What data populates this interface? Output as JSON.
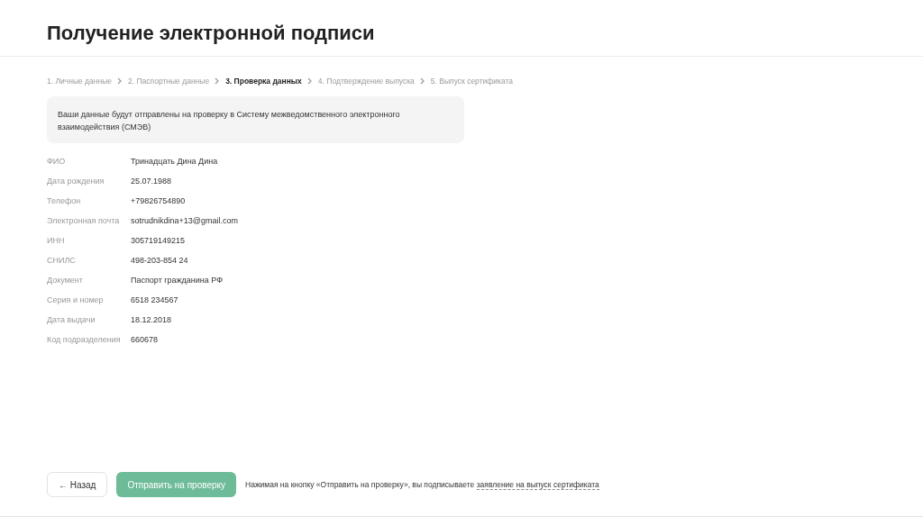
{
  "title": "Получение электронной подписи",
  "steps": [
    {
      "label": "1. Личные данные",
      "selected": false
    },
    {
      "label": "2. Паспортные данные",
      "selected": false
    },
    {
      "label": "3. Проверка данных",
      "selected": true
    },
    {
      "label": "4. Подтверждение выпуска",
      "selected": false
    },
    {
      "label": "5. Выпуск сертификата",
      "selected": false
    }
  ],
  "notice": "Ваши данные будут отправлены на проверку в Систему межведомственного электронного взаимодействия (СМЭВ)",
  "fields": [
    {
      "label": "ФИО",
      "value": "Тринадцать Дина Дина"
    },
    {
      "label": "Дата рождения",
      "value": "25.07.1988"
    },
    {
      "label": "Телефон",
      "value": "+79826754890"
    },
    {
      "label": "Электронная почта",
      "value": "sotrudnikdina+13@gmail.com"
    },
    {
      "label": "ИНН",
      "value": "305719149215"
    },
    {
      "label": "СНИЛС",
      "value": "498-203-854 24"
    },
    {
      "label": "Документ",
      "value": "Паспорт гражданина РФ"
    },
    {
      "label": "Серия и номер",
      "value": "6518 234567"
    },
    {
      "label": "Дата выдачи",
      "value": "18.12.2018"
    },
    {
      "label": "Код подразделения",
      "value": "660678"
    }
  ],
  "back_button": {
    "arrow": "←",
    "label": "Назад"
  },
  "submit_button": "Отправить на проверку",
  "footer_note": {
    "text": "Нажимая на кнопку «Отправить на проверку», вы подписываете",
    "link": "заявление на выпуск сертификата"
  }
}
